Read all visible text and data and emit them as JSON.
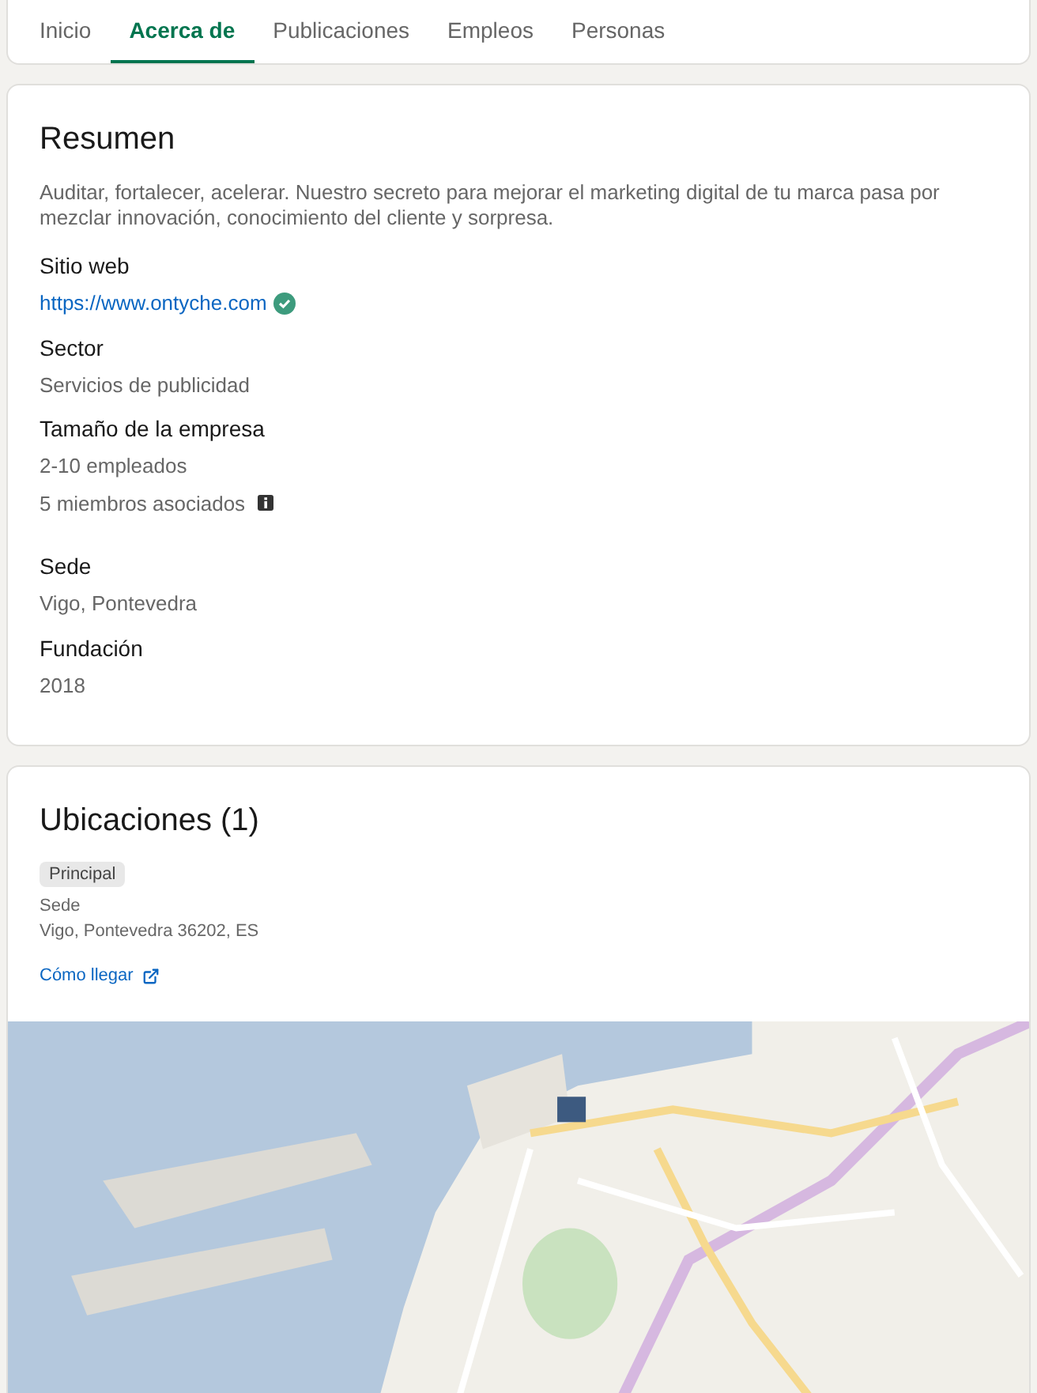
{
  "tabs": [
    {
      "label": "Inicio",
      "selected": false
    },
    {
      "label": "Acerca de",
      "selected": true
    },
    {
      "label": "Publicaciones",
      "selected": false
    },
    {
      "label": "Empleos",
      "selected": false
    },
    {
      "label": "Personas",
      "selected": false
    }
  ],
  "summary": {
    "title": "Resumen",
    "description": "Auditar, fortalecer, acelerar. Nuestro secreto para mejorar el marketing digital de tu marca pasa por mezclar innovación, conocimiento del cliente y sorpresa.",
    "fields": [
      {
        "label": "Sitio web",
        "values": [
          {
            "kind": "link",
            "text": "https://www.ontyche.com",
            "verified": true
          }
        ]
      },
      {
        "label": "Sector",
        "values": [
          {
            "kind": "text",
            "text": "Servicios de publicidad"
          }
        ]
      },
      {
        "label": "Tamaño de la empresa",
        "values": [
          {
            "kind": "text",
            "text": "2-10 empleados"
          },
          {
            "kind": "info",
            "text": "5 miembros asociados"
          }
        ]
      },
      {
        "label": "Sede",
        "values": [
          {
            "kind": "text",
            "text": "Vigo, Pontevedra"
          }
        ]
      },
      {
        "label": "Fundación",
        "values": [
          {
            "kind": "text",
            "text": "2018"
          }
        ]
      }
    ]
  },
  "locations": {
    "title": "Ubicaciones (1)",
    "items": [
      {
        "badge": "Principal",
        "name": "Sede",
        "address": "Vigo, Pontevedra 36202, ES",
        "directions": "Cómo llegar"
      }
    ]
  }
}
